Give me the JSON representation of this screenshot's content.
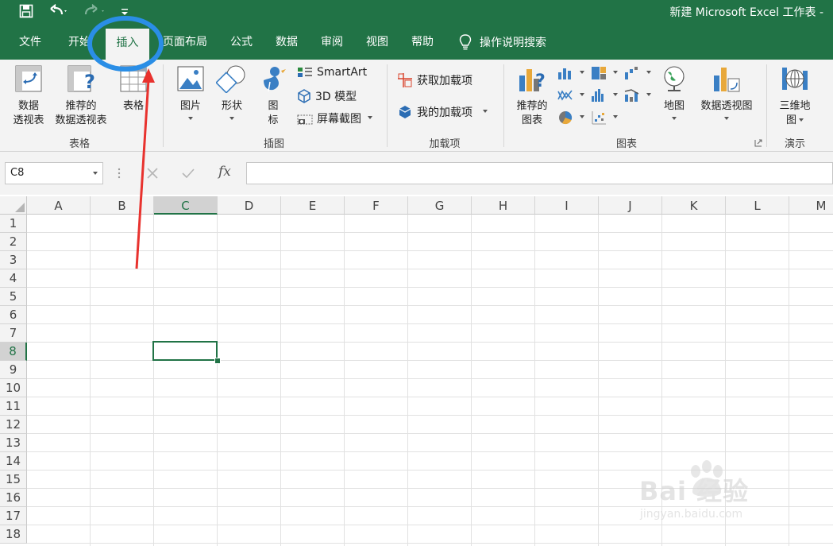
{
  "window": {
    "title": "新建 Microsoft Excel 工作表 -"
  },
  "tabs": [
    {
      "label": "文件"
    },
    {
      "label": "开始"
    },
    {
      "label": "插入"
    },
    {
      "label": "页面布局"
    },
    {
      "label": "公式"
    },
    {
      "label": "数据"
    },
    {
      "label": "审阅"
    },
    {
      "label": "视图"
    },
    {
      "label": "帮助"
    }
  ],
  "active_tab": "插入",
  "tell_me": {
    "label": "操作说明搜索"
  },
  "ribbon": {
    "groups": {
      "tables": {
        "label": "表格",
        "buttons": [
          "数据透视表",
          "推荐的数据透视表",
          "表格"
        ]
      },
      "illustrations": {
        "label": "插图",
        "buttons": [
          "图片",
          "形状",
          "图标"
        ],
        "small": [
          "SmartArt",
          "3D 模型",
          "屏幕截图"
        ]
      },
      "addins": {
        "label": "加载项",
        "buttons": [
          "获取加载项",
          "我的加载项"
        ]
      },
      "charts": {
        "label": "图表",
        "buttons": [
          "推荐的图表",
          "地图",
          "数据透视图"
        ]
      },
      "tours": {
        "label": "演示",
        "buttons": [
          "三维地图"
        ]
      }
    }
  },
  "formula_bar": {
    "name_box": "C8",
    "fx_symbol": "fx",
    "value": ""
  },
  "sheet": {
    "columns": [
      "A",
      "B",
      "C",
      "D",
      "E",
      "F",
      "G",
      "H",
      "I",
      "J",
      "K",
      "L",
      "M"
    ],
    "rows": [
      "1",
      "2",
      "3",
      "4",
      "5",
      "6",
      "7",
      "8",
      "9",
      "10",
      "11",
      "12",
      "13",
      "14",
      "15",
      "16",
      "17",
      "18"
    ],
    "selected_cell": "C8"
  },
  "watermark": {
    "brand": "Bai 经验",
    "url": "jingyan.baidu.com"
  },
  "colors": {
    "excel_green": "#217346",
    "annotation_red": "#e8322e",
    "annotation_blue": "#2a8ee6"
  }
}
